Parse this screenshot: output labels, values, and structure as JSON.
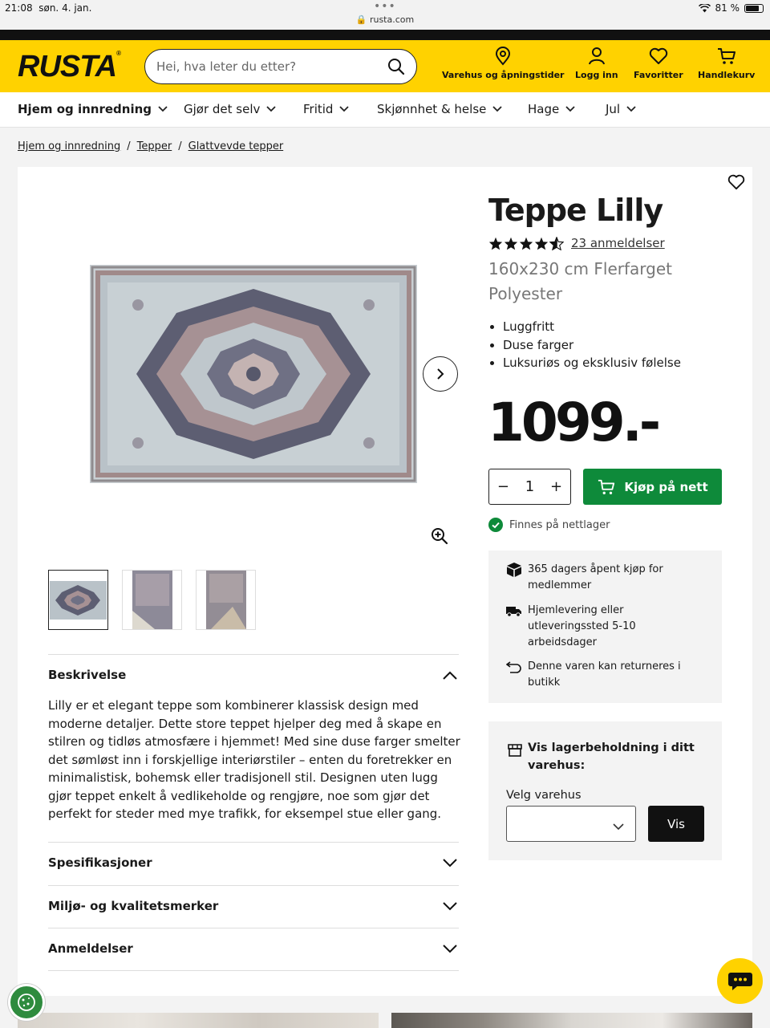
{
  "statusbar": {
    "time": "21:08",
    "date": "søn. 4. jan.",
    "url": "rusta.com",
    "battery": "81 %",
    "battery_level": 0.81
  },
  "header": {
    "logo": "RUSTA",
    "search_placeholder": "Hei, hva leter du etter?",
    "nav": [
      {
        "label": "Varehus og åpningstider",
        "icon": "location-pin-icon"
      },
      {
        "label": "Logg inn",
        "icon": "user-icon"
      },
      {
        "label": "Favoritter",
        "icon": "heart-icon"
      },
      {
        "label": "Handlekurv",
        "icon": "cart-icon"
      }
    ]
  },
  "categories": [
    "Hjem og innredning",
    "Gjør det selv",
    "Fritid",
    "Skjønnhet & helse",
    "Hage",
    "Jul"
  ],
  "breadcrumb": [
    "Hjem og innredning",
    "Tepper",
    "Glattvevde tepper"
  ],
  "product": {
    "title": "Teppe Lilly",
    "rating": 4.5,
    "reviews": "23 anmeldelser",
    "subtitle": "160x230 cm Flerfarget Polyester",
    "bullets": [
      "Luggfritt",
      "Duse farger",
      "Luksuriøs og eksklusiv følelse"
    ],
    "price": "1099.-",
    "quantity": "1",
    "buy_label": "Kjøp på nett",
    "stock": "Finnes på nettlager"
  },
  "info": [
    {
      "icon": "box-icon",
      "text": "365 dagers åpent kjøp for medlemmer"
    },
    {
      "icon": "truck-icon",
      "text": "Hjemlevering eller utleveringssted 5-10 arbeidsdager"
    },
    {
      "icon": "return-icon",
      "text": "Denne varen kan returneres i butikk"
    }
  ],
  "store": {
    "title": "Vis lagerbeholdning i ditt varehus:",
    "select_label": "Velg varehus",
    "select_value": "",
    "button": "Vis"
  },
  "accordion": {
    "description_title": "Beskrivelse",
    "description_text": "Lilly er et elegant teppe som kombinerer klassisk design med moderne detaljer. Dette store teppet hjelper deg med å skape en stilren og tidløs atmosfære i hjemmet! Med sine duse farger smelter det sømløst inn i forskjellige interiørstiler – enten du foretrekker en minimalistisk, bohemsk eller tradisjonell stil. Designen uten lugg gjør teppet enkelt å vedlikeholde og rengjøre, noe som gjør det perfekt for steder med mye trafikk, for eksempel stue eller gang.",
    "sections": [
      "Spesifikasjoner",
      "Miljø- og kvalitetsmerker",
      "Anmeldelser"
    ]
  },
  "colors": {
    "brand_yellow": "#ffd200",
    "buy_green": "#0e8a3a"
  }
}
